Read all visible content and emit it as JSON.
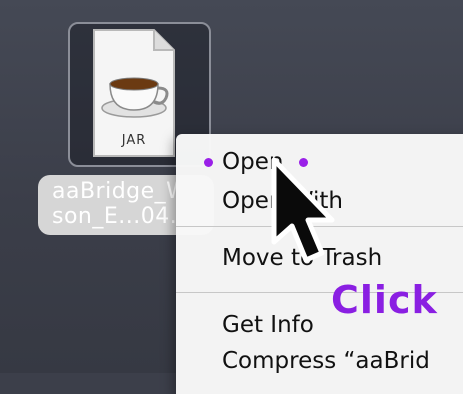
{
  "file": {
    "icon_name": "jar-file-icon",
    "badge": "JAR",
    "name_line1": "aaBridge_Wa",
    "name_line2": "son_E...04.jar"
  },
  "context_menu": {
    "items": [
      {
        "label": "Open"
      },
      {
        "label": "Open With"
      },
      {
        "label": "Move to Trash"
      },
      {
        "label": "Get Info"
      },
      {
        "label": "Compress “aaBrid"
      }
    ]
  },
  "annotation": {
    "text": "Click",
    "color": "#8a1fe2"
  },
  "cursor": {
    "icon_name": "arrow-pointer-icon"
  }
}
